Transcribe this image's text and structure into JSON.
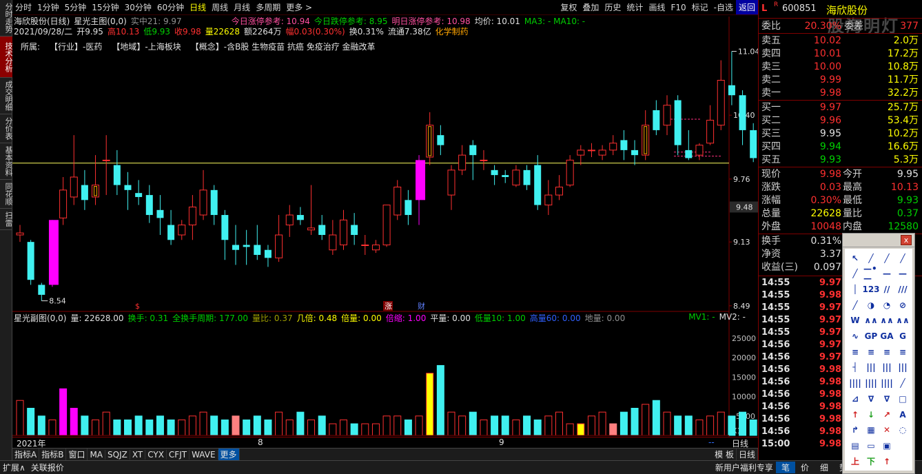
{
  "toolbar": {
    "periods": [
      "分时",
      "1分钟",
      "5分钟",
      "15分钟",
      "30分钟",
      "60分钟",
      "日线",
      "周线",
      "月线",
      "多周期",
      "更多 >"
    ],
    "active_period": "日线",
    "actions": [
      "复权",
      "叠加",
      "历史",
      "统计",
      "画线",
      "F10",
      "标记",
      "-自选",
      "返回"
    ]
  },
  "left_tabs": [
    "分时走势",
    "技术分析",
    "成交明细",
    "分价表",
    "基本资料",
    "同花顺",
    "扫雷"
  ],
  "header": {
    "row1": {
      "title": "海欣股份(日线)",
      "main_indicator": "星光主图(0,0)",
      "realtime": "实中21: 9.97",
      "ref1": "今日涨停参考: 10.94",
      "ref2": "今日跌停参考: 8.95",
      "ref3": "明日涨停参考: 10.98",
      "avg": "均价: 10.01",
      "ma": "MA3: -  MA10: -"
    },
    "row2": {
      "date": "2021/09/28/二",
      "open": "开9.95",
      "high": "高10.13",
      "low": "低9.93",
      "close": "收9.98",
      "vol": "量22628",
      "amount": "额2264万",
      "change": "幅0.03(0.30%)",
      "turnover": "换0.31%",
      "float": "流通7.38亿",
      "sector": "化学制药"
    },
    "row3": {
      "label": "所属:",
      "industry": "【行业】-医药",
      "region": "【地域】-上海板块",
      "concept": "【概念】-含B股 生物疫苗 抗癌 免疫治疗 金融改革"
    }
  },
  "chart_data": {
    "type": "candlestick",
    "y_axis_ticks": [
      "10.40",
      "9.76",
      "9.48",
      "9.13",
      "8.49"
    ],
    "y_range": [
      8.42,
      11.14
    ],
    "current_price_marker": "9.48",
    "annotations": {
      "high": "11.04",
      "low": "8.54"
    },
    "event_markers": [
      "$",
      "涨",
      "财"
    ],
    "x_labels": [
      "2021年",
      "8",
      "9"
    ],
    "period_label": "日线",
    "candles": [
      [
        9.2,
        9.22,
        9.3,
        9.13
      ],
      [
        9.13,
        8.75,
        9.15,
        8.7
      ],
      [
        8.7,
        8.6,
        8.72,
        8.54
      ],
      [
        8.7,
        9.35,
        9.35,
        8.68
      ],
      [
        9.37,
        9.65,
        9.78,
        9.3
      ],
      [
        9.58,
        9.78,
        10.2,
        9.5
      ],
      [
        9.7,
        9.55,
        9.85,
        9.45
      ],
      [
        9.58,
        9.7,
        10.0,
        9.5
      ],
      [
        9.95,
        9.95,
        10.2,
        9.6
      ],
      [
        9.9,
        9.7,
        10.05,
        9.6
      ],
      [
        9.7,
        9.65,
        9.83,
        9.45
      ],
      [
        9.62,
        9.58,
        9.75,
        9.5
      ],
      [
        9.6,
        9.4,
        9.7,
        9.32
      ],
      [
        9.45,
        9.37,
        9.6,
        9.2
      ],
      [
        9.3,
        9.15,
        9.45,
        9.1
      ],
      [
        9.2,
        9.3,
        9.35,
        9.15
      ],
      [
        9.3,
        9.48,
        9.6,
        9.15
      ],
      [
        9.4,
        9.65,
        9.85,
        9.35
      ],
      [
        9.65,
        9.4,
        9.7,
        9.3
      ],
      [
        9.4,
        9.15,
        9.45,
        8.95
      ],
      [
        9.1,
        9.05,
        9.3,
        8.9
      ],
      [
        9.1,
        9.08,
        9.25,
        8.9
      ],
      [
        9.1,
        9.0,
        9.3,
        8.95
      ],
      [
        9.05,
        8.97,
        9.1,
        8.88
      ],
      [
        8.97,
        9.2,
        9.4,
        8.93
      ],
      [
        9.3,
        9.4,
        9.5,
        9.18
      ],
      [
        9.4,
        9.35,
        9.48,
        9.3
      ],
      [
        9.25,
        9.27,
        9.7,
        9.2
      ],
      [
        9.3,
        9.2,
        9.4,
        9.15
      ],
      [
        9.05,
        9.2,
        9.35,
        9.0
      ],
      [
        9.1,
        9.35,
        9.45,
        9.05
      ],
      [
        9.3,
        9.2,
        9.42,
        9.1
      ],
      [
        9.1,
        9.1,
        9.2,
        9.0
      ],
      [
        9.05,
        9.1,
        9.15,
        9.02
      ],
      [
        9.1,
        9.5,
        9.5,
        9.08
      ],
      [
        9.4,
        9.68,
        9.75,
        9.35
      ],
      [
        9.55,
        9.4,
        9.65,
        9.3
      ],
      [
        9.55,
        9.95,
        10.0,
        9.3
      ],
      [
        9.98,
        10.3,
        10.43,
        9.9
      ],
      [
        10.2,
        10.1,
        10.3,
        10.0
      ],
      [
        9.6,
        9.85,
        9.9,
        9.45
      ],
      [
        9.85,
        10.0,
        10.1,
        9.8
      ],
      [
        10.1,
        10.0,
        10.15,
        9.75
      ],
      [
        9.95,
        9.95,
        10.05,
        9.85
      ],
      [
        9.85,
        9.8,
        9.9,
        9.7
      ],
      [
        9.8,
        9.78,
        9.85,
        9.72
      ],
      [
        9.7,
        9.85,
        9.9,
        9.68
      ],
      [
        9.85,
        9.7,
        9.9,
        9.65
      ],
      [
        9.9,
        9.5,
        10.0,
        9.45
      ],
      [
        9.5,
        9.6,
        9.75,
        9.4
      ],
      [
        9.6,
        9.68,
        9.8,
        9.55
      ],
      [
        9.7,
        9.95,
        10.0,
        9.68
      ],
      [
        10.0,
        10.05,
        10.1,
        9.9
      ],
      [
        10.05,
        10.05,
        10.12,
        9.98
      ],
      [
        10.0,
        10.05,
        10.1,
        9.95
      ],
      [
        10.05,
        10.12,
        10.2,
        10.0
      ],
      [
        10.15,
        10.05,
        10.25,
        9.95
      ],
      [
        10.05,
        10.0,
        10.15,
        9.9
      ],
      [
        10.0,
        10.3,
        10.45,
        9.95
      ],
      [
        10.45,
        10.25,
        10.55,
        10.2
      ],
      [
        10.3,
        10.5,
        10.6,
        10.2
      ],
      [
        10.55,
        10.1,
        10.6,
        10.0
      ],
      [
        10.05,
        9.97,
        10.25,
        9.95
      ],
      [
        10.0,
        10.1,
        10.12,
        9.95
      ],
      [
        10.12,
        10.35,
        10.5,
        10.1
      ],
      [
        10.3,
        10.75,
        10.95,
        10.25
      ],
      [
        10.7,
        10.6,
        11.04,
        10.5
      ],
      [
        10.6,
        10.25,
        10.65,
        10.1
      ],
      [
        10.25,
        9.97,
        10.32,
        9.93
      ],
      [
        9.95,
        9.98,
        10.13,
        9.93
      ]
    ],
    "sub_chart": {
      "title": "星光副图(0,0)",
      "y_ticks": [
        "25000",
        "20000",
        "15000",
        "10000",
        "5000",
        "X10"
      ],
      "volumes": [
        9,
        7,
        5,
        4,
        12,
        7,
        5,
        4,
        6,
        4,
        4,
        5,
        4,
        5,
        4,
        4,
        5,
        6,
        5,
        4,
        5,
        4,
        5,
        4,
        6,
        4,
        6,
        4,
        5,
        3,
        4,
        3,
        3,
        3,
        5,
        5,
        4,
        5,
        16,
        18,
        6,
        5,
        6,
        4,
        5,
        5,
        4,
        5,
        4,
        5,
        6,
        3,
        3,
        5,
        6,
        3,
        6,
        7,
        8,
        9,
        6,
        5,
        5,
        4,
        5,
        6,
        5,
        6,
        4,
        2
      ],
      "labels": [
        "量: 22628.00",
        "换手: 0.31",
        "全换手周期: 177.00",
        "量比: 0.37",
        "几倍: 0.48",
        "倍量: 0.00",
        "倍缩: 1.00",
        "平量: 0.00",
        "低量10: 1.00",
        "高量60: 0.00",
        "地量: 0.00",
        "MV1: -",
        "MV2: -"
      ]
    }
  },
  "right_panel": {
    "code": "600851",
    "name": "海欣股份",
    "watermark": "股海明灯",
    "weibi": {
      "label": "委比",
      "value": "20.30%",
      "label2": "委差",
      "value2": "377"
    },
    "sell": [
      {
        "label": "卖五",
        "price": "10.02",
        "vol": "2.0万"
      },
      {
        "label": "卖四",
        "price": "10.01",
        "vol": "17.2万"
      },
      {
        "label": "卖三",
        "price": "10.00",
        "vol": "10.8万"
      },
      {
        "label": "卖二",
        "price": "9.99",
        "vol": "11.7万"
      },
      {
        "label": "卖一",
        "price": "9.98",
        "vol": "32.2万"
      }
    ],
    "buy": [
      {
        "label": "买一",
        "price": "9.97",
        "vol": "25.7万"
      },
      {
        "label": "买二",
        "price": "9.96",
        "vol": "53.4万"
      },
      {
        "label": "买三",
        "price": "9.95",
        "vol": "10.2万"
      },
      {
        "label": "买四",
        "price": "9.94",
        "vol": "16.6万"
      },
      {
        "label": "买五",
        "price": "9.93",
        "vol": "5.3万"
      }
    ],
    "stats": [
      {
        "l1": "现价",
        "v1": "9.98",
        "l2": "今开",
        "v2": "9.95"
      },
      {
        "l1": "涨跌",
        "v1": "0.03",
        "l2": "最高",
        "v2": "10.13"
      },
      {
        "l1": "涨幅",
        "v1": "0.30%",
        "l2": "最低",
        "v2": "9.93"
      },
      {
        "l1": "总量",
        "v1": "22628",
        "l2": "量比",
        "v2": "0.37"
      },
      {
        "l1": "外盘",
        "v1": "10048",
        "l2": "内盘",
        "v2": "12580"
      }
    ],
    "stats2": [
      {
        "l": "换手",
        "v": "0.31%"
      },
      {
        "l": "净资",
        "v": "3.37"
      },
      {
        "l": "收益(三)",
        "v": "0.097"
      }
    ],
    "ticks": [
      {
        "t": "14:55",
        "p": "9.97"
      },
      {
        "t": "14:55",
        "p": "9.98"
      },
      {
        "t": "14:55",
        "p": "9.97"
      },
      {
        "t": "14:55",
        "p": "9.97"
      },
      {
        "t": "14:55",
        "p": "9.97"
      },
      {
        "t": "14:56",
        "p": "9.97"
      },
      {
        "t": "14:56",
        "p": "9.97"
      },
      {
        "t": "14:56",
        "p": "9.98"
      },
      {
        "t": "14:56",
        "p": "9.98"
      },
      {
        "t": "14:56",
        "p": "9.98"
      },
      {
        "t": "14:56",
        "p": "9.98"
      },
      {
        "t": "14:56",
        "p": "9.98"
      },
      {
        "t": "14:56",
        "p": "9.98"
      },
      {
        "t": "15:00",
        "p": "9.98"
      }
    ]
  },
  "bottom_tabs": [
    "指标A",
    "指标B",
    "窗口",
    "MA",
    "SQJZ",
    "XT",
    "CYX",
    "CFJT",
    "WAVE",
    "更多"
  ],
  "bottom_right": [
    "模 板",
    "日线"
  ],
  "status_bar": {
    "left": [
      "扩展∧",
      "关联报价"
    ],
    "right": [
      "新用户福利专享",
      "笔",
      "价",
      "细",
      "势"
    ]
  },
  "draw_tools_title": "x",
  "draw_tools": [
    "↖",
    "╱",
    "╱",
    "╱",
    "╱",
    "—•—",
    "—",
    "—",
    "│",
    "123",
    "//",
    "///",
    "╱",
    "◑",
    "◔",
    "⊘",
    "W",
    "∧∧",
    "∧∧",
    "∧∧",
    "∿",
    "GP",
    "GA",
    "G",
    "≡",
    "≡",
    "≡",
    "≡",
    "┤",
    "|||",
    "|||",
    "|||",
    "||||",
    "||||",
    "||||",
    "╱",
    "⊿",
    "∇",
    "∇",
    "□",
    "↑",
    "↓",
    "↗",
    "A",
    "↱",
    "▦",
    "✕",
    "◌",
    "▤",
    "▭",
    "▣",
    "",
    "上",
    "下",
    "↑",
    ""
  ]
}
